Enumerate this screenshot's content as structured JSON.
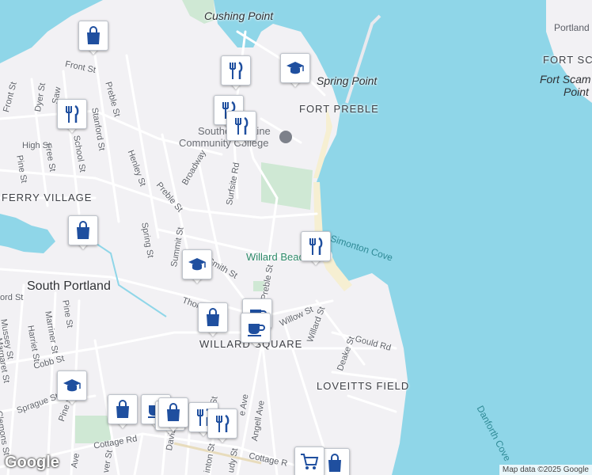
{
  "colors": {
    "water": "#8fd6e8",
    "land": "#f2f1f4",
    "park": "#cfe8d4",
    "road": "#ffffff",
    "pin_icon": "#1f4f9f",
    "marker": "#1e9e7a"
  },
  "places": {
    "cushing_point": "Cushing Point",
    "spring_point": "Spring Point",
    "fort_preble": "FORT PREBLE",
    "fort_sca": "FORT SCA",
    "fort_scammel_point_1": "Fort Scam",
    "fort_scammel_point_2": "Point",
    "portland": "Portland",
    "college_1": "Southern Maine",
    "college_2": "Community College",
    "ferry_village": "FERRY VILLAGE",
    "south_portland": "South Portland",
    "willard_square": "WILLARD SQUARE",
    "loveitts_field": "LOVEITTS FIELD",
    "willard_beach": "Willard Beach",
    "simonton_cove": "Simonton Cove",
    "danforth_cove": "Danforth Cove"
  },
  "streets": {
    "front_st_1": "Front St",
    "front_st_2": "Front St",
    "preble_st_top": "Preble St",
    "dyer_st": "Dyer St",
    "sawyer": "Saw",
    "stanford_st": "Stanford St",
    "school_st": "School St",
    "high_st": "High St",
    "free_st": "Free St",
    "pine_st_top": "Pine St",
    "henley_st": "Henley St",
    "broadway": "Broadway",
    "surfsite_rd": "Surfsite Rd",
    "preble_st_mid": "Preble St",
    "spring_st": "Spring St",
    "summit_st": "Summit St",
    "smith_st": "Smith St",
    "preble_st_south": "Preble St",
    "thornton": "Thor",
    "willow_st": "Willow St",
    "willard_st": "Willard St",
    "gould_rd": "Gould Rd",
    "deake_st": "Deake St",
    "ford": "ord St",
    "mussey_st": "Mussey St",
    "harriet_st": "Harriet St",
    "marriner_st": "Marriner St",
    "pine_st_s": "Pine St",
    "margaret_st": "Margaret St",
    "cobb_st": "Cobb St",
    "sprague_st": "Sprague St",
    "clemons_st": "Clemons St",
    "pine_st_bottom": "Pine St",
    "cottage_rd_1": "Cottage Rd",
    "cottage_rd_2": "Cottage R",
    "davis_st": "Davis St",
    "angell_ave": "Angell Ave",
    "ave_1": "Ave",
    "ave_2": "e Ave",
    "ver_st": "ver St",
    "inton_st": "inton St",
    "udy_st": "udy St",
    "st_small": "St"
  },
  "pins": [
    {
      "type": "shopping-bag-icon"
    },
    {
      "type": "restaurant-icon"
    },
    {
      "type": "school-icon"
    },
    {
      "type": "restaurant-icon"
    },
    {
      "type": "restaurant-icon"
    },
    {
      "type": "restaurant-icon"
    },
    {
      "type": "shopping-bag-icon"
    },
    {
      "type": "restaurant-icon"
    },
    {
      "type": "school-icon"
    },
    {
      "type": "cafe-icon"
    },
    {
      "type": "shopping-bag-icon"
    },
    {
      "type": "cafe-icon"
    },
    {
      "type": "school-icon"
    },
    {
      "type": "shopping-bag-icon"
    },
    {
      "type": "cafe-icon"
    },
    {
      "type": "shopping-bag-icon"
    },
    {
      "type": "restaurant-icon"
    },
    {
      "type": "restaurant-icon"
    },
    {
      "type": "shopping-bag-icon"
    },
    {
      "type": "grocery-cart-icon"
    },
    {
      "type": "shopping-bag-icon"
    }
  ],
  "logo": "Google",
  "attribution": "Map data ©2025 Google"
}
